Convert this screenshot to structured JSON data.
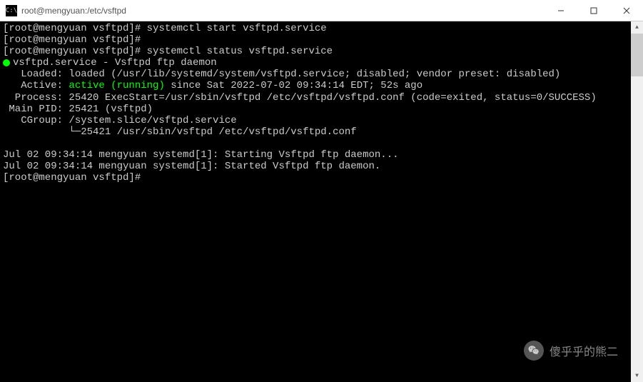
{
  "titlebar": {
    "icon_text": "C:\\",
    "title": "root@mengyuan:/etc/vsftpd"
  },
  "terminal": {
    "prompt1": "[root@mengyuan vsftpd]# ",
    "cmd1": "systemctl start vsftpd.service",
    "prompt2": "[root@mengyuan vsftpd]# ",
    "prompt3": "[root@mengyuan vsftpd]# ",
    "cmd3": "systemctl status vsftpd.service",
    "service_name": "vsftpd.service - Vsftpd ftp daemon",
    "loaded_line": "   Loaded: loaded (/usr/lib/systemd/system/vsftpd.service; disabled; vendor preset: disabled)",
    "active_prefix": "   Active: ",
    "active_status": "active (running)",
    "active_suffix": " since Sat 2022-07-02 09:34:14 EDT; 52s ago",
    "process_line": "  Process: 25420 ExecStart=/usr/sbin/vsftpd /etc/vsftpd/vsftpd.conf (code=exited, status=0/SUCCESS)",
    "mainpid_line": " Main PID: 25421 (vsftpd)",
    "cgroup_line": "   CGroup: /system.slice/vsftpd.service",
    "cgroup_child": "           └─25421 /usr/sbin/vsftpd /etc/vsftpd/vsftpd.conf",
    "log1": "Jul 02 09:34:14 mengyuan systemd[1]: Starting Vsftpd ftp daemon...",
    "log2": "Jul 02 09:34:14 mengyuan systemd[1]: Started Vsftpd ftp daemon.",
    "prompt4": "[root@mengyuan vsftpd]# "
  },
  "watermark": {
    "text": "傻乎乎的熊二"
  }
}
